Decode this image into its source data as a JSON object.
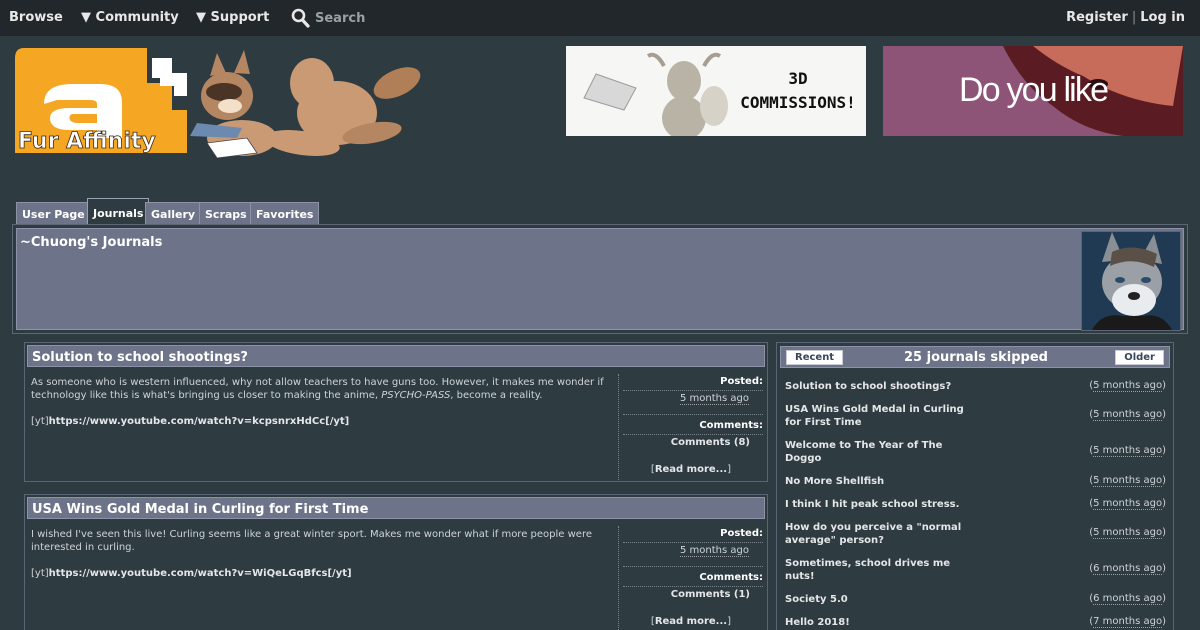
{
  "nav": {
    "browse": "Browse",
    "community": "▼ Community",
    "support": "▼ Support",
    "search_placeholder": "Search",
    "register": "Register",
    "separator": "|",
    "login": "Log in"
  },
  "logo_text": "Fur Affinity",
  "banner1_text": [
    "3D",
    "COMMISSIONS!"
  ],
  "banner2_text": "Do you like",
  "tabs": [
    "User Page",
    "Journals",
    "Gallery",
    "Scraps",
    "Favorites"
  ],
  "active_tab": "Journals",
  "header": {
    "title": "~Chuong's Journals"
  },
  "journals": [
    {
      "title": "Solution to school shootings?",
      "text_plain": "As someone who is western influenced, why not allow teachers to have guns too. However, it makes me wonder if technology like this is what's bringing us closer to making the anime, ",
      "text_em": "PSYCHO-PASS",
      "text_tail": ", become a reality.",
      "yt_prefix": "[yt]",
      "yt_link": "https://www.youtube.com/watch?v=kcpsnrxHdCc[/yt]",
      "posted_label": "Posted:",
      "posted_value": "5 months ago",
      "comments_label": "Comments:",
      "comments_value": "Comments (8)",
      "more_open": "[",
      "more_text": "Read more...",
      "more_close": "]"
    },
    {
      "title": "USA Wins Gold Medal in Curling for First Time",
      "text_plain": "I wished I've seen this live! Curling seems like a great winter sport. Makes me wonder what if more people were interested in curling.",
      "text_em": "",
      "text_tail": "",
      "yt_prefix": "[yt]",
      "yt_link": "https://www.youtube.com/watch?v=WiQeLGqBfcs[/yt]",
      "posted_label": "Posted:",
      "posted_value": "5 months ago",
      "comments_label": "Comments:",
      "comments_value": "Comments (1)",
      "more_open": "[",
      "more_text": "Read more...",
      "more_close": "]"
    }
  ],
  "sidebar": {
    "recent": "Recent",
    "skipped": "25 journals skipped",
    "older": "Older",
    "items": [
      {
        "title": "Solution to school shootings?",
        "ago": "5 months ago"
      },
      {
        "title": "USA Wins Gold Medal in Curling for First Time",
        "ago": "5 months ago"
      },
      {
        "title": "Welcome to The Year of The Doggo",
        "ago": "5 months ago"
      },
      {
        "title": "No More Shellfish",
        "ago": "5 months ago"
      },
      {
        "title": "I think I hit peak school stress.",
        "ago": "5 months ago"
      },
      {
        "title": "How do you perceive a \"normal average\" person?",
        "ago": "5 months ago"
      },
      {
        "title": "Sometimes, school drives me nuts!",
        "ago": "6 months ago"
      },
      {
        "title": "Society 5.0",
        "ago": "6 months ago"
      },
      {
        "title": "Hello 2018!",
        "ago": "7 months ago"
      }
    ]
  },
  "colors": {
    "background": "#2e3b41",
    "topnav": "#22272b",
    "panel": "#6d7489",
    "logo_orange": "#f5a623"
  }
}
